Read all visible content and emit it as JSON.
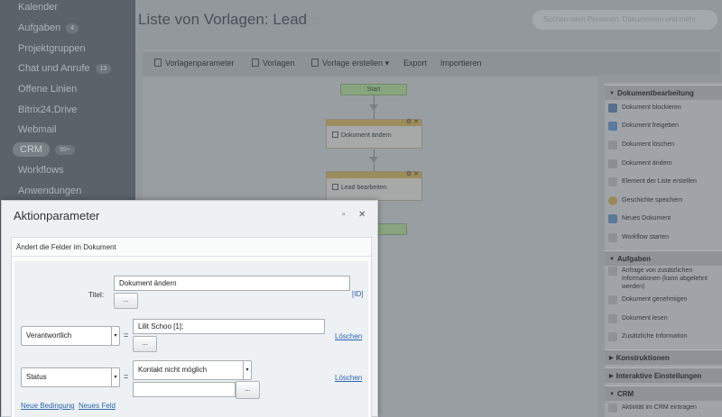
{
  "sidebar": {
    "items": [
      {
        "label": "Kalender",
        "counter": ""
      },
      {
        "label": "Aufgaben",
        "counter": "4"
      },
      {
        "label": "Projektgruppen",
        "counter": ""
      },
      {
        "label": "Chat und Anrufe",
        "counter": "13"
      },
      {
        "label": "Offene Linien",
        "counter": ""
      },
      {
        "label": "Bitrix24.Drive",
        "counter": ""
      },
      {
        "label": "Webmail",
        "counter": ""
      },
      {
        "label": "CRM",
        "counter": "99+"
      },
      {
        "label": "Workflows",
        "counter": ""
      },
      {
        "label": "Anwendungen",
        "counter": ""
      }
    ]
  },
  "header": {
    "title": "Liste von Vorlagen: Lead",
    "star": "☆",
    "search_placeholder": "Suchen nach Personen, Dokumenten und mehr"
  },
  "toolbar": {
    "items": [
      "Vorlagenparameter",
      "Vorlagen",
      "Vorlage erstellen",
      "Export",
      "Importieren"
    ],
    "dropdown_arrow": "▾"
  },
  "workflow": {
    "start_label": "Start",
    "activities": [
      {
        "label": "Dokument ändern"
      },
      {
        "label": "Lead bearbeiten"
      }
    ],
    "controls": "⚙ ✕"
  },
  "right_panel": {
    "sections": [
      {
        "title": "Dokumentbearbeitung",
        "items": [
          "Dokument blockieren",
          "Dokument freigeben",
          "Dokument löschen",
          "Dokument ändern",
          "Element der Liste erstellen",
          "Geschichte speichern",
          "Neues Dokument",
          "Workflow starten"
        ]
      },
      {
        "title": "Aufgaben",
        "items": [
          "Anfrage von zusätzlichen Informationen (kann abgelehnt werden)",
          "Dokument genehmigen",
          "Dokument lesen",
          "Zusätzliche Information"
        ]
      },
      {
        "title": "Konstruktionen",
        "items": []
      },
      {
        "title": "Interaktive Einstellungen",
        "items": []
      },
      {
        "title": "CRM",
        "items": [
          "Aktivität im CRM eintragen"
        ]
      }
    ],
    "arrow_open": "▼",
    "arrow_closed": "▶"
  },
  "dialog": {
    "title": "Aktionparameter",
    "maximize_icon": "▫",
    "close_icon": "✕",
    "subtitle": "Ändert die Felder im Dokument",
    "title_label": "Titel:",
    "title_value": "Dokument ändern",
    "title_dots": "...",
    "id_link": "[ID]",
    "rows": [
      {
        "field": "Verantwortlich",
        "equals": "=",
        "value": "Lilit Schoo [1];",
        "dots": "...",
        "delete": "Löschen"
      },
      {
        "field": "Status",
        "equals": "=",
        "value": "Kontakt nicht möglich",
        "dots": "...",
        "delete": "Löschen"
      }
    ],
    "new_condition": "Neue Bedingung",
    "new_field": "Neues Feld",
    "dropdown_arrow": "▾"
  },
  "colors": {
    "link": "#2a66b0",
    "sidebar_bg": "#5b6268",
    "overlay_bg": "#93989d"
  }
}
